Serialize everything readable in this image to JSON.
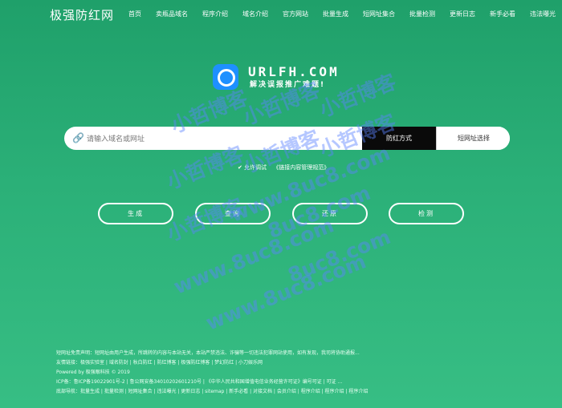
{
  "brand": "极强防红网",
  "nav": [
    "首页",
    "卖瓶品域名",
    "程序介绍",
    "域名介绍",
    "官方网站",
    "批量生成",
    "短网址集合",
    "批量检测",
    "更新日志",
    "新手必看",
    "违法曝光"
  ],
  "logo": {
    "title": "URLFH.COM",
    "subtitle": "解决误报推广难题!"
  },
  "search": {
    "placeholder": "请输入域名或网址",
    "mode": "防红方式",
    "short": "短网址选择"
  },
  "options": {
    "item1": "允许调试",
    "item2": "《链接内容管理规范》"
  },
  "buttons": {
    "generate": "生成",
    "query": "查询",
    "restore": "还原",
    "detect": "检测"
  },
  "footer": {
    "line1": "短网址免责声明：短网址由用户生成，所跳转的内容与本站无关，本站严禁违法、诈骗等一切违法犯罪网站使用，如有发现，我司将协助通报...",
    "line2": "友情链接：极强实验室 | 域名防封 | 秋白防红 | 防红博客 | 极强防红博客 | 梦幻防红 | 小刀娱乐网",
    "line3": "Powered by 极强眼科技 © 2019",
    "line4": "ICP备：鲁ICP备19022901号-2 | 鲁公网安备34010202601210号 | 《中华人民共和国增值电信业务经营许可证》编号可证 | 可证 ...",
    "line5": "底部导航：批量生成 | 批量检测 | 短网址集合 | 违法曝光 | 更新日志 | sitemap | 新手必看 | 对接文档 | 会员介绍 | 程序介绍 | 程序介绍 | 程序介绍"
  },
  "watermarks": [
    "小哲博客",
    "小哲博客",
    "小哲博客",
    "小哲博客",
    "小哲博客",
    "小哲博客",
    "小哲博客",
    "8uc8.com",
    "8uc8.com",
    "www.8uc8.com",
    "www.8uc8.com",
    "www.8uc8.com"
  ]
}
